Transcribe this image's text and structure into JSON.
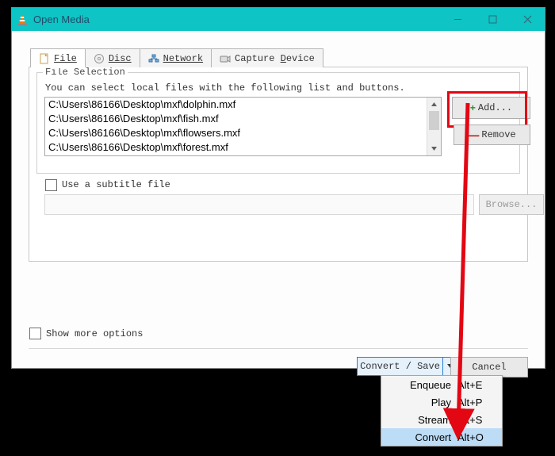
{
  "window": {
    "title": "Open Media"
  },
  "tabs": {
    "file": "File",
    "disc": "Disc",
    "network": "Network",
    "capture": "Capture Device"
  },
  "file_selection": {
    "legend": "File Selection",
    "hint": "You can select local files with the following list and buttons.",
    "files": [
      "C:\\Users\\86166\\Desktop\\mxf\\dolphin.mxf",
      "C:\\Users\\86166\\Desktop\\mxf\\fish.mxf",
      "C:\\Users\\86166\\Desktop\\mxf\\flowsers.mxf",
      "C:\\Users\\86166\\Desktop\\mxf\\forest.mxf"
    ],
    "add_label": "Add...",
    "remove_label": "Remove"
  },
  "subtitle": {
    "label": "Use a subtitle file",
    "browse_label": "Browse..."
  },
  "more_options_label": "Show more options",
  "footer": {
    "convert_save_label": "Convert / Save",
    "cancel_label": "Cancel"
  },
  "dropdown": {
    "items": [
      {
        "label": "Enqueue",
        "shortcut": "Alt+E"
      },
      {
        "label": "Play",
        "shortcut": "Alt+P"
      },
      {
        "label": "Stream",
        "shortcut": "Alt+S"
      },
      {
        "label": "Convert",
        "shortcut": "Alt+O"
      }
    ],
    "selected_index": 3
  }
}
